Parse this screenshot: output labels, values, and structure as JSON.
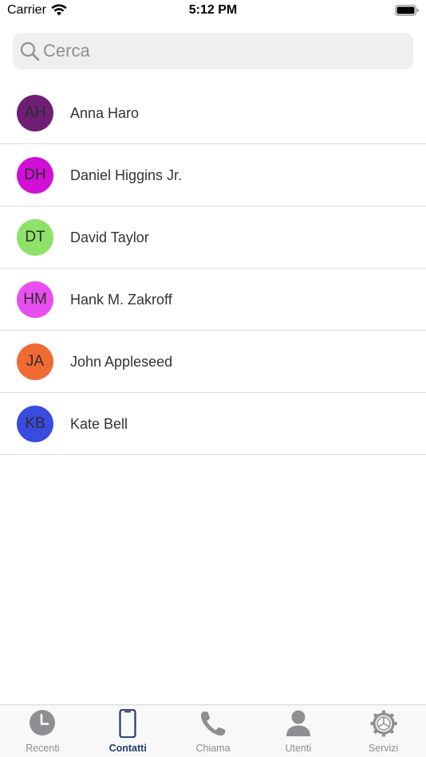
{
  "status_bar": {
    "carrier": "Carrier",
    "time": "5:12 PM"
  },
  "search": {
    "placeholder": "Cerca",
    "value": ""
  },
  "contacts": [
    {
      "initials": "AH",
      "name": "Anna Haro",
      "color": "#6e1e75"
    },
    {
      "initials": "DH",
      "name": "Daniel Higgins Jr.",
      "color": "#d10fd6"
    },
    {
      "initials": "DT",
      "name": "David Taylor",
      "color": "#8fe169"
    },
    {
      "initials": "HM",
      "name": "Hank M. Zakroff",
      "color": "#e94ff0"
    },
    {
      "initials": "JA",
      "name": "John Appleseed",
      "color": "#f06a34"
    },
    {
      "initials": "KB",
      "name": "Kate Bell",
      "color": "#3a4be0"
    }
  ],
  "tab_bar": {
    "active_color": "#1f3d6e",
    "inactive_color": "#8e8e93",
    "tabs": [
      {
        "label": "Recenti",
        "icon": "clock-icon",
        "active": false
      },
      {
        "label": "Contatti",
        "icon": "phone-device-icon",
        "active": true
      },
      {
        "label": "Chiama",
        "icon": "phone-handset-icon",
        "active": false
      },
      {
        "label": "Utenti",
        "icon": "user-icon",
        "active": false
      },
      {
        "label": "Servizi",
        "icon": "gear-icon",
        "active": false
      }
    ]
  }
}
